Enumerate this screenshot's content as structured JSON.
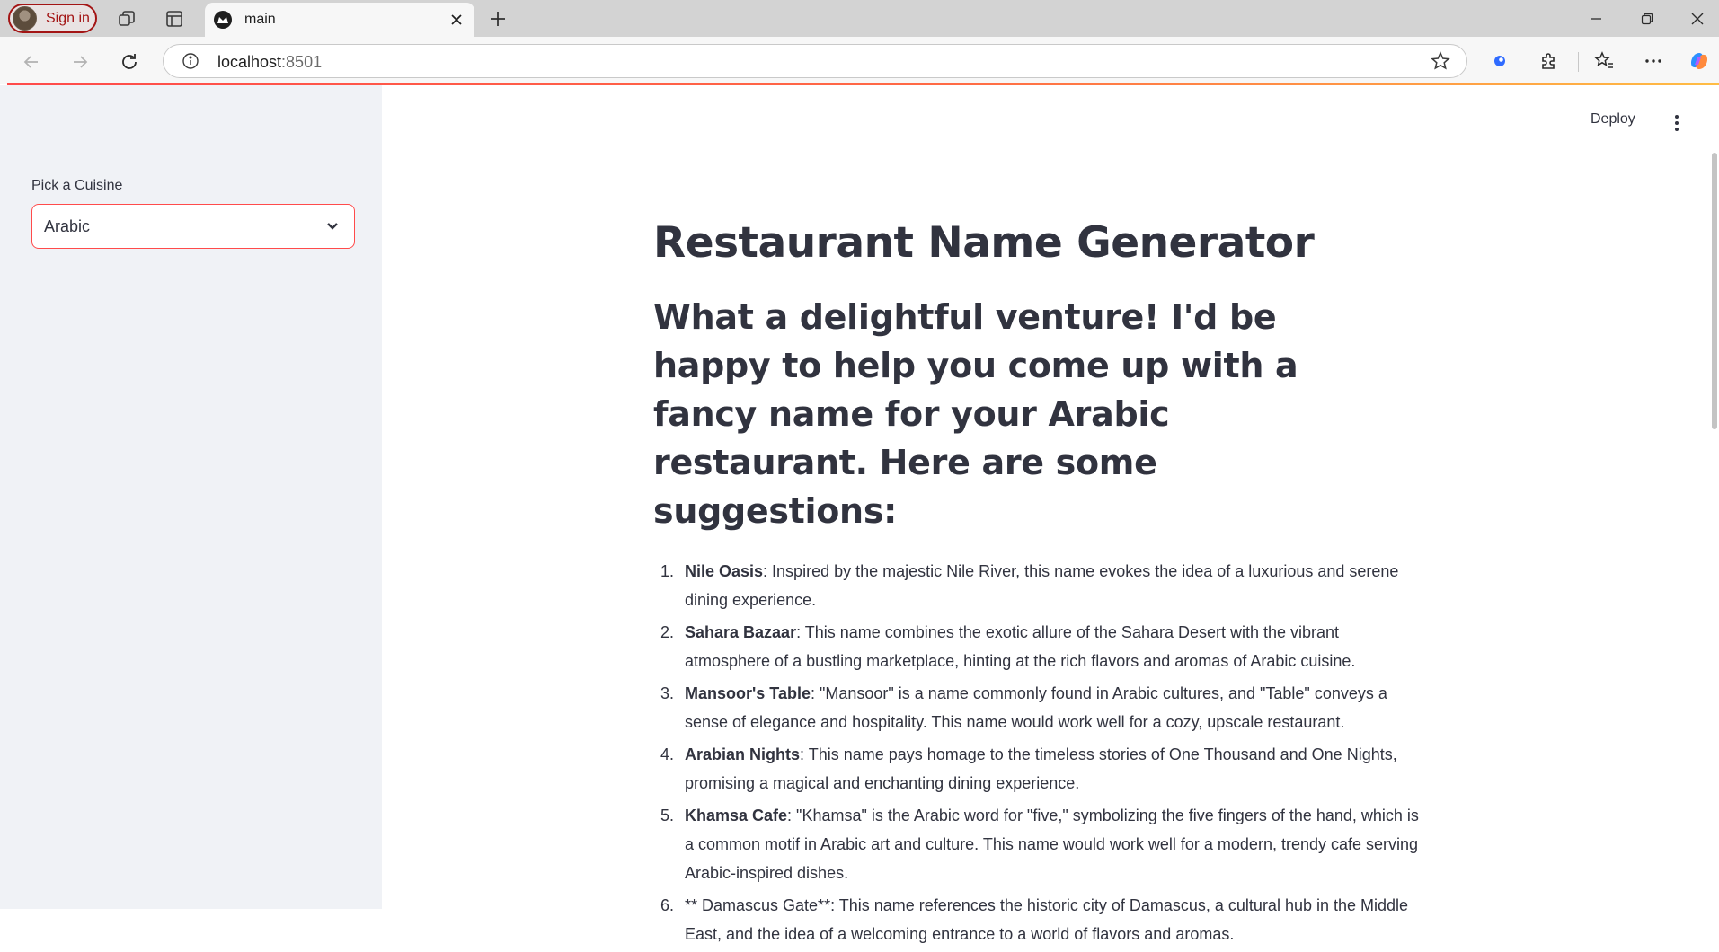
{
  "browser": {
    "profile": {
      "signin_label": "Sign in"
    },
    "tab": {
      "title": "main"
    },
    "address_bar": {
      "host": "localhost",
      "port": ":8501"
    }
  },
  "sidebar": {
    "select_label": "Pick a Cuisine",
    "selected_value": "Arabic"
  },
  "header": {
    "deploy_label": "Deploy"
  },
  "main": {
    "title": "Restaurant Name Generator",
    "intro": "What a delightful venture! I'd be happy to help you come up with a fancy name for your Arabic restaurant. Here are some suggestions:",
    "suggestions": [
      {
        "num": "1.",
        "name": "Nile Oasis",
        "desc": ": Inspired by the majestic Nile River, this name evokes the idea of a luxurious and serene dining experience."
      },
      {
        "num": "2.",
        "name": "Sahara Bazaar",
        "desc": ": This name combines the exotic allure of the Sahara Desert with the vibrant atmosphere of a bustling marketplace, hinting at the rich flavors and aromas of Arabic cuisine."
      },
      {
        "num": "3.",
        "name": "Mansoor's Table",
        "desc": ": \"Mansoor\" is a name commonly found in Arabic cultures, and \"Table\" conveys a sense of elegance and hospitality. This name would work well for a cozy, upscale restaurant."
      },
      {
        "num": "4.",
        "name": "Arabian Nights",
        "desc": ": This name pays homage to the timeless stories of One Thousand and One Nights, promising a magical and enchanting dining experience."
      },
      {
        "num": "5.",
        "name": "Khamsa Cafe",
        "desc": ": \"Khamsa\" is the Arabic word for \"five,\" symbolizing the five fingers of the hand, which is a common motif in Arabic art and culture. This name would work well for a modern, trendy cafe serving Arabic-inspired dishes."
      },
      {
        "num": "6.",
        "name": "",
        "desc": "** Damascus Gate**: This name references the historic city of Damascus, a cultural hub in the Middle East, and the idea of a welcoming entrance to a world of flavors and aromas."
      }
    ]
  },
  "colors": {
    "accent": "#ff4b4b",
    "sidebar_bg": "#f0f2f6",
    "text": "#31333f",
    "signin_red": "#a31515"
  },
  "icons": [
    "profile-avatar-icon",
    "workspaces-icon",
    "tab-actions-icon",
    "streamlit-favicon-icon",
    "close-icon",
    "plus-icon",
    "minimize-icon",
    "restore-icon",
    "window-close-icon",
    "back-icon",
    "forward-icon",
    "reload-icon",
    "info-icon",
    "star-icon",
    "copilot-extension-icon",
    "puzzle-icon",
    "favorites-icon",
    "more-icon",
    "copilot-icon",
    "chevron-down-icon",
    "kebab-menu-icon"
  ]
}
